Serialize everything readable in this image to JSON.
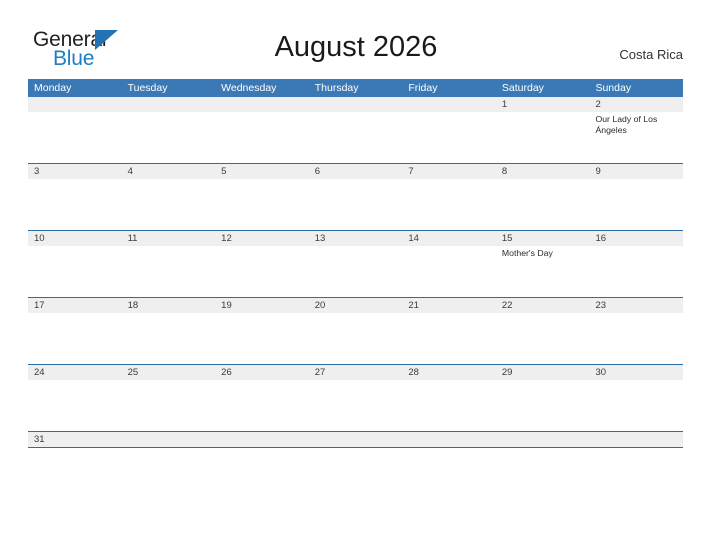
{
  "brand": {
    "name_part1": "General",
    "name_part2": "Blue",
    "flag_icon": "flag-triangle-icon",
    "accent_color": "#1d7ec4"
  },
  "header": {
    "title": "August 2026",
    "location": "Costa Rica"
  },
  "theme": {
    "header_blue": "#3b79b6",
    "row_divider_blue": "#2e6da4",
    "date_band_gray": "#efefef",
    "page_background": "#ffffff",
    "text_color": "#2b2b2b"
  },
  "calendar": {
    "month": "August",
    "year": "2026",
    "weekday_headers": [
      "Monday",
      "Tuesday",
      "Wednesday",
      "Thursday",
      "Friday",
      "Saturday",
      "Sunday"
    ],
    "weeks": [
      {
        "dates": [
          "",
          "",
          "",
          "",
          "",
          "1",
          "2"
        ],
        "events": [
          "",
          "",
          "",
          "",
          "",
          "",
          "Our Lady of Los Ángeles"
        ]
      },
      {
        "dates": [
          "3",
          "4",
          "5",
          "6",
          "7",
          "8",
          "9"
        ],
        "events": [
          "",
          "",
          "",
          "",
          "",
          "",
          ""
        ]
      },
      {
        "dates": [
          "10",
          "11",
          "12",
          "13",
          "14",
          "15",
          "16"
        ],
        "events": [
          "",
          "",
          "",
          "",
          "",
          "Mother's Day",
          ""
        ]
      },
      {
        "dates": [
          "17",
          "18",
          "19",
          "20",
          "21",
          "22",
          "23"
        ],
        "events": [
          "",
          "",
          "",
          "",
          "",
          "",
          ""
        ]
      },
      {
        "dates": [
          "24",
          "25",
          "26",
          "27",
          "28",
          "29",
          "30"
        ],
        "events": [
          "",
          "",
          "",
          "",
          "",
          "",
          ""
        ]
      },
      {
        "dates": [
          "31",
          "",
          "",
          "",
          "",
          "",
          ""
        ],
        "events": [
          "",
          "",
          "",
          "",
          "",
          "",
          ""
        ]
      }
    ]
  }
}
